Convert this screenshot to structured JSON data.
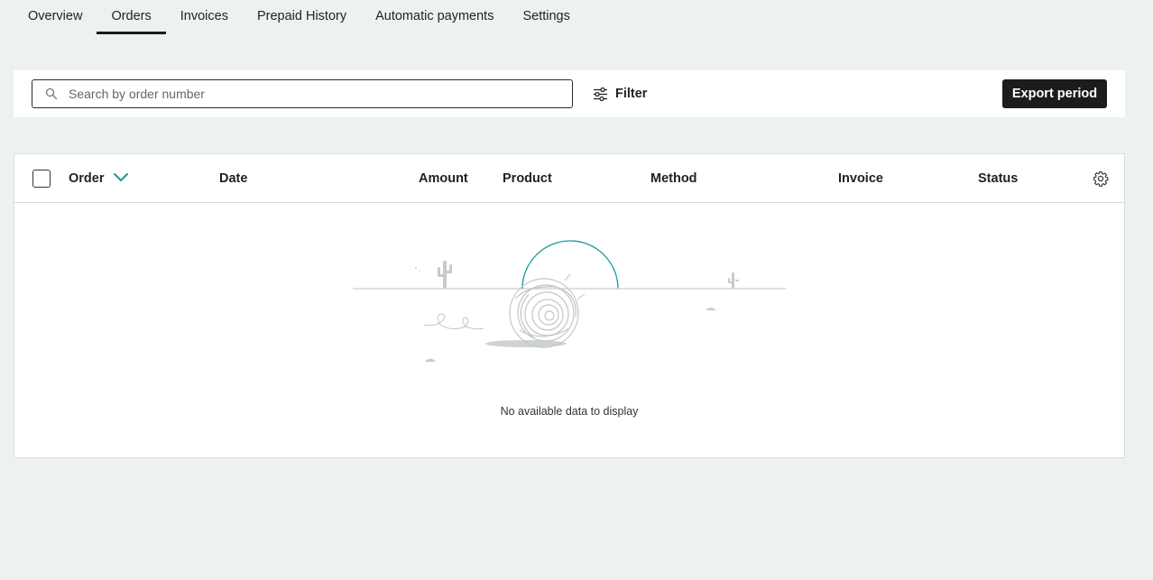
{
  "tabs": [
    {
      "label": "Overview"
    },
    {
      "label": "Orders"
    },
    {
      "label": "Invoices"
    },
    {
      "label": "Prepaid History"
    },
    {
      "label": "Automatic payments"
    },
    {
      "label": "Settings"
    }
  ],
  "active_tab": "Orders",
  "toolbar": {
    "search_placeholder": "Search by order number",
    "search_value": "",
    "filter_label": "Filter",
    "export_label": "Export period"
  },
  "table": {
    "columns": {
      "order": "Order",
      "date": "Date",
      "amount": "Amount",
      "product": "Product",
      "method": "Method",
      "invoice": "Invoice",
      "status": "Status"
    },
    "rows": [],
    "empty_message": "No available data to display"
  },
  "icons": {
    "search": "search-icon",
    "filter": "sliders-icon",
    "sort": "chevron-down-icon",
    "settings": "gear-icon"
  },
  "colors": {
    "accent": "#1a9a9a",
    "primary_button": "#1c1c1c",
    "page_background": "#eef1f2"
  }
}
